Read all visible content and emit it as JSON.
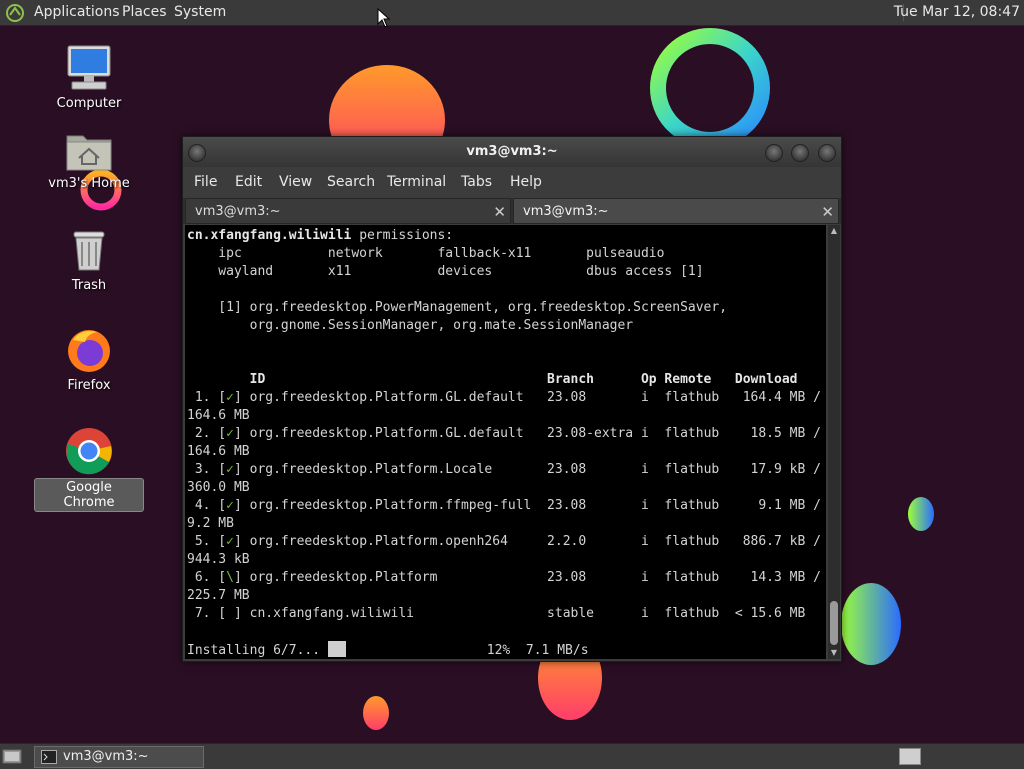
{
  "top_panel": {
    "menus": [
      "Applications",
      "Places",
      "System"
    ],
    "clock": "Tue Mar 12, 08:47"
  },
  "desktop": {
    "icons": [
      {
        "label": "Computer",
        "icon": "computer-icon"
      },
      {
        "label": "vm3's Home",
        "icon": "home-folder-icon"
      },
      {
        "label": "Trash",
        "icon": "trash-icon"
      },
      {
        "label": "Firefox",
        "icon": "firefox-icon"
      },
      {
        "label": "Google Chrome",
        "icon": "chrome-icon"
      }
    ],
    "selected_icon": "Google Chrome"
  },
  "window": {
    "title": "vm3@vm3:~",
    "menus": [
      "File",
      "Edit",
      "View",
      "Search",
      "Terminal",
      "Tabs",
      "Help"
    ],
    "tabs": [
      {
        "label": "vm3@vm3:~",
        "active": false
      },
      {
        "label": "vm3@vm3:~",
        "active": true
      }
    ]
  },
  "terminal": {
    "app_id": "cn.xfangfang.wiliwili",
    "permissions_label": " permissions:",
    "perm_line1": "    ipc           network       fallback-x11       pulseaudio",
    "perm_line2": "    wayland       x11           devices            dbus access [1]",
    "note_line1": "    [1] org.freedesktop.PowerManagement, org.freedesktop.ScreenSaver,",
    "note_line2": "        org.gnome.SessionManager, org.mate.SessionManager",
    "header": "        ID                                    Branch      Op Remote   Download",
    "rows": [
      {
        "num": " 1. [",
        "mark": "✓",
        "rest": "] org.freedesktop.Platform.GL.default   23.08       i  flathub   164.4 MB /",
        "cont": "164.6 MB"
      },
      {
        "num": " 2. [",
        "mark": "✓",
        "rest": "] org.freedesktop.Platform.GL.default   23.08-extra i  flathub    18.5 MB /",
        "cont": "164.6 MB"
      },
      {
        "num": " 3. [",
        "mark": "✓",
        "rest": "] org.freedesktop.Platform.Locale       23.08       i  flathub    17.9 kB /",
        "cont": "360.0 MB"
      },
      {
        "num": " 4. [",
        "mark": "✓",
        "rest": "] org.freedesktop.Platform.ffmpeg-full  23.08       i  flathub     9.1 MB /",
        "cont": "9.2 MB"
      },
      {
        "num": " 5. [",
        "mark": "✓",
        "rest": "] org.freedesktop.Platform.openh264     2.2.0       i  flathub   886.7 kB /",
        "cont": "944.3 kB"
      },
      {
        "num": " 6. [",
        "mark": "\\",
        "rest": "] org.freedesktop.Platform              23.08       i  flathub    14.3 MB /",
        "cont": "225.7 MB"
      },
      {
        "num": " 7. [",
        "mark": " ",
        "rest": "] cn.xfangfang.wiliwili                 stable      i  flathub  < 15.6 MB",
        "cont": ""
      }
    ],
    "status_text": "Installing 6/7... ",
    "status_progress": "                  12%  7.1 MB/s"
  },
  "bottom_panel": {
    "task_label": "vm3@vm3:~"
  },
  "colors": {
    "desktop_bg": "#2a0f24",
    "panel_bg": "#3a3a3a",
    "terminal_bg": "#000000",
    "check_green": "#6fbf3a"
  }
}
